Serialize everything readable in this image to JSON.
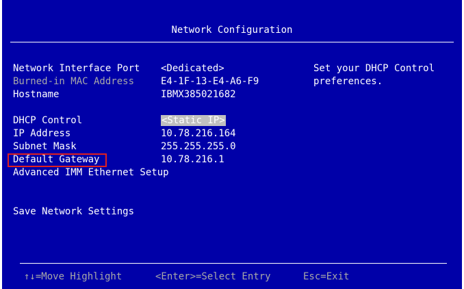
{
  "title": "Network Configuration",
  "fields": {
    "network_interface_port": {
      "label": "Network Interface Port",
      "value": "<Dedicated>"
    },
    "burned_in_mac": {
      "label": "Burned-in MAC Address",
      "value": "E4-1F-13-E4-A6-F9"
    },
    "hostname": {
      "label": "Hostname",
      "value": "IBMX385021682"
    },
    "dhcp_control": {
      "label": "DHCP Control",
      "value": "<Static IP>"
    },
    "ip_address": {
      "label": "IP Address",
      "value": "10.78.216.164"
    },
    "subnet_mask": {
      "label": "Subnet Mask",
      "value": "255.255.255.0"
    },
    "default_gateway": {
      "label": "Default Gateway",
      "value": "10.78.216.1"
    },
    "advanced_setup": {
      "label": "Advanced IMM Ethernet Setup"
    },
    "save_settings": {
      "label": "Save Network Settings"
    }
  },
  "help": {
    "line1": "Set your DHCP Control",
    "line2": "preferences."
  },
  "footer": {
    "move": "↑↓=Move Highlight",
    "select": "<Enter>=Select Entry",
    "exit": "Esc=Exit"
  },
  "colors": {
    "background": "#0000a8",
    "text": "#ffffff",
    "disabled_text": "#a8a8a8",
    "selection": "#c0c0c0",
    "annotation_box": "#e02020"
  }
}
